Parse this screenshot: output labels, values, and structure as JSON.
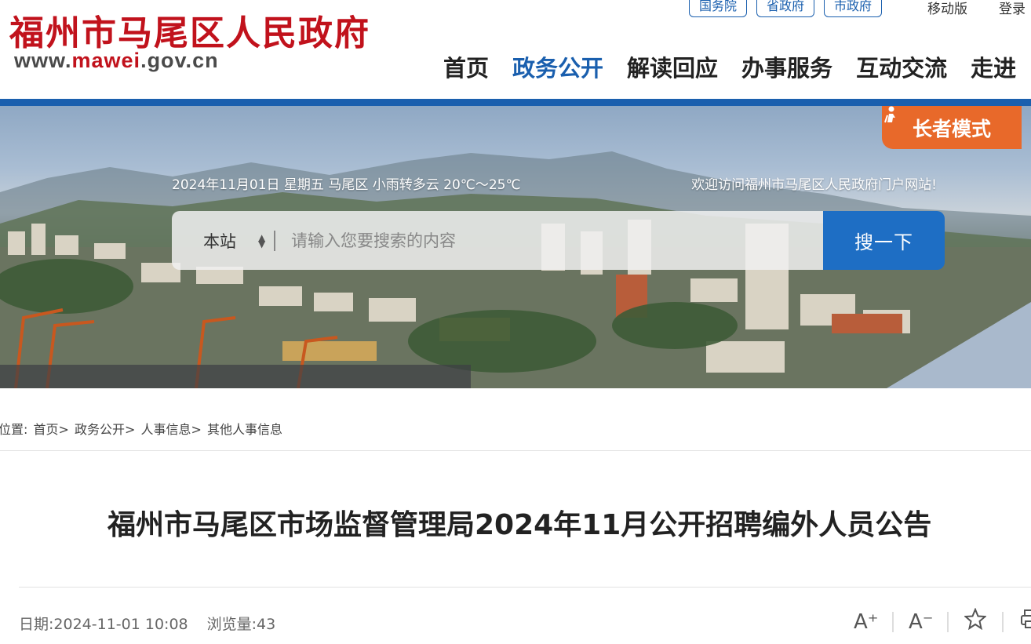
{
  "header": {
    "site_title": "福州市马尾区人民政府",
    "url_prefix": "www.",
    "url_highlight": "mawei",
    "url_suffix": ".gov.cn"
  },
  "top_links": {
    "guowuyuan": "国务院",
    "shengzhengfu": "省政府",
    "shizhengfu": "市政府",
    "mobile": "移动版",
    "login": "登录"
  },
  "nav": {
    "home": "首页",
    "gov_affairs": "政务公开",
    "interpretation": "解读回应",
    "services": "办事服务",
    "interaction": "互动交流",
    "enter": "走进"
  },
  "banner": {
    "elder_mode": "长者模式",
    "weather": "2024年11月01日 星期五 马尾区 小雨转多云 20℃～25℃",
    "welcome": "欢迎访问福州市马尾区人民政府门户网站!",
    "search_scope": "本站",
    "search_placeholder": "请输入您要搜索的内容",
    "search_button": "搜一下"
  },
  "breadcrumb": {
    "prefix": "位置:",
    "items": [
      "首页>",
      "政务公开>",
      "人事信息>",
      "其他人事信息"
    ]
  },
  "article": {
    "title": "福州市马尾区市场监督管理局2024年11月公开招聘编外人员公告",
    "date_label": "日期:",
    "date_value": "2024-11-01 10:08",
    "views_label": "浏览量:",
    "views_value": "43"
  },
  "tools": {
    "font_larger": "A⁺",
    "font_smaller": "A⁻",
    "favorite_icon": "star-icon",
    "print_icon": "printer-icon"
  },
  "colors": {
    "brand_red": "#c1121c",
    "brand_blue": "#1a5fae",
    "elder_orange": "#e8692a",
    "search_blue": "#1e6ec4"
  }
}
